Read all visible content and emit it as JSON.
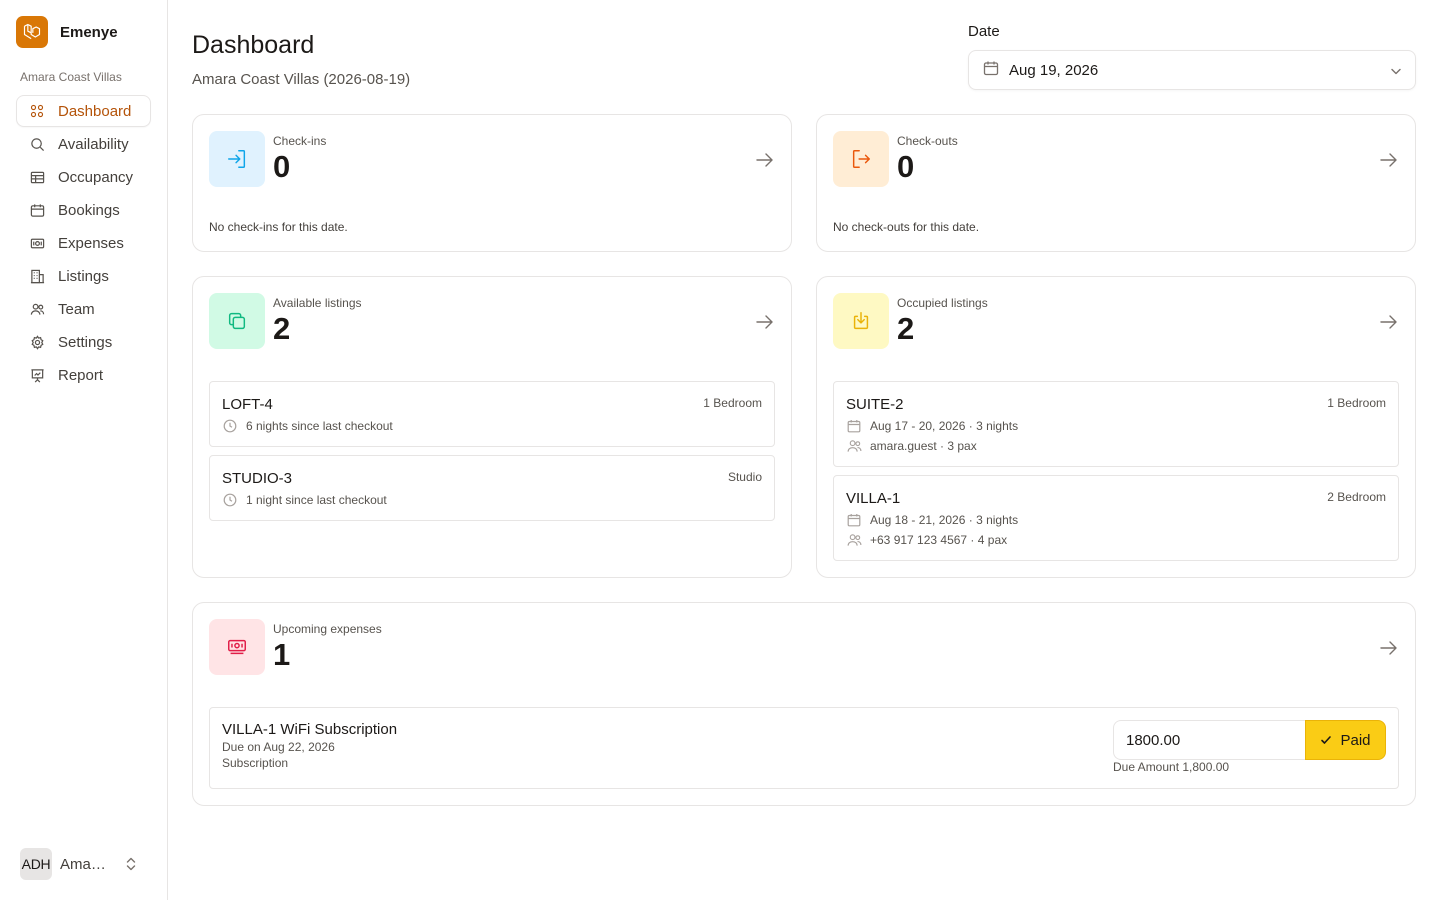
{
  "brand": {
    "name": "Emenye",
    "logo_icon": "laravel-logo-icon",
    "accent": "#d97706"
  },
  "sidebar": {
    "org": "Amara Coast Villas",
    "items": [
      {
        "label": "Dashboard",
        "icon": "grid-icon",
        "active": true
      },
      {
        "label": "Availability",
        "icon": "search-icon",
        "active": false
      },
      {
        "label": "Occupancy",
        "icon": "table-icon",
        "active": false
      },
      {
        "label": "Bookings",
        "icon": "calendar-icon",
        "active": false
      },
      {
        "label": "Expenses",
        "icon": "banknote-icon",
        "active": false
      },
      {
        "label": "Listings",
        "icon": "building-icon",
        "active": false
      },
      {
        "label": "Team",
        "icon": "users-icon",
        "active": false
      },
      {
        "label": "Settings",
        "icon": "gear-icon",
        "active": false
      },
      {
        "label": "Report",
        "icon": "presentation-chart-icon",
        "active": false
      }
    ],
    "user": {
      "initials": "ADH",
      "name": "Amara Coast Villas Host"
    }
  },
  "header": {
    "title": "Dashboard",
    "subtitle": "Amara Coast Villas (2026-08-19)",
    "date_label": "Date",
    "date_value": "Aug 19, 2026"
  },
  "cards": {
    "checkins": {
      "label": "Check-ins",
      "value": "0",
      "note": "No check-ins for this date.",
      "color": "#0ea5e9"
    },
    "checkouts": {
      "label": "Check-outs",
      "value": "0",
      "note": "No check-outs for this date.",
      "color": "#ea580c"
    },
    "available": {
      "label": "Available listings",
      "value": "2",
      "color": "#10b981",
      "items": [
        {
          "name": "LOFT-4",
          "type": "1 Bedroom",
          "detail": "6 nights since last checkout"
        },
        {
          "name": "STUDIO-3",
          "type": "Studio",
          "detail": "1 night since last checkout"
        }
      ]
    },
    "occupied": {
      "label": "Occupied listings",
      "value": "2",
      "color": "#eab308",
      "items": [
        {
          "name": "SUITE-2",
          "type": "1 Bedroom",
          "dates": "Aug 17 - 20, 2026 · 3 nights",
          "guest": "amara.guest · 3 pax"
        },
        {
          "name": "VILLA-1",
          "type": "2 Bedroom",
          "dates": "Aug 18 - 21, 2026 · 3 nights",
          "guest": "+63 917 123 4567 · 4 pax"
        }
      ]
    },
    "expenses": {
      "label": "Upcoming expenses",
      "value": "1",
      "color": "#e11d48",
      "items": [
        {
          "title": "VILLA-1 WiFi Subscription",
          "due": "Due on Aug 22, 2026",
          "category": "Subscription",
          "amount_input": "1800.00",
          "paid_label": "Paid",
          "due_amount": "Due Amount 1,800.00"
        }
      ]
    }
  }
}
